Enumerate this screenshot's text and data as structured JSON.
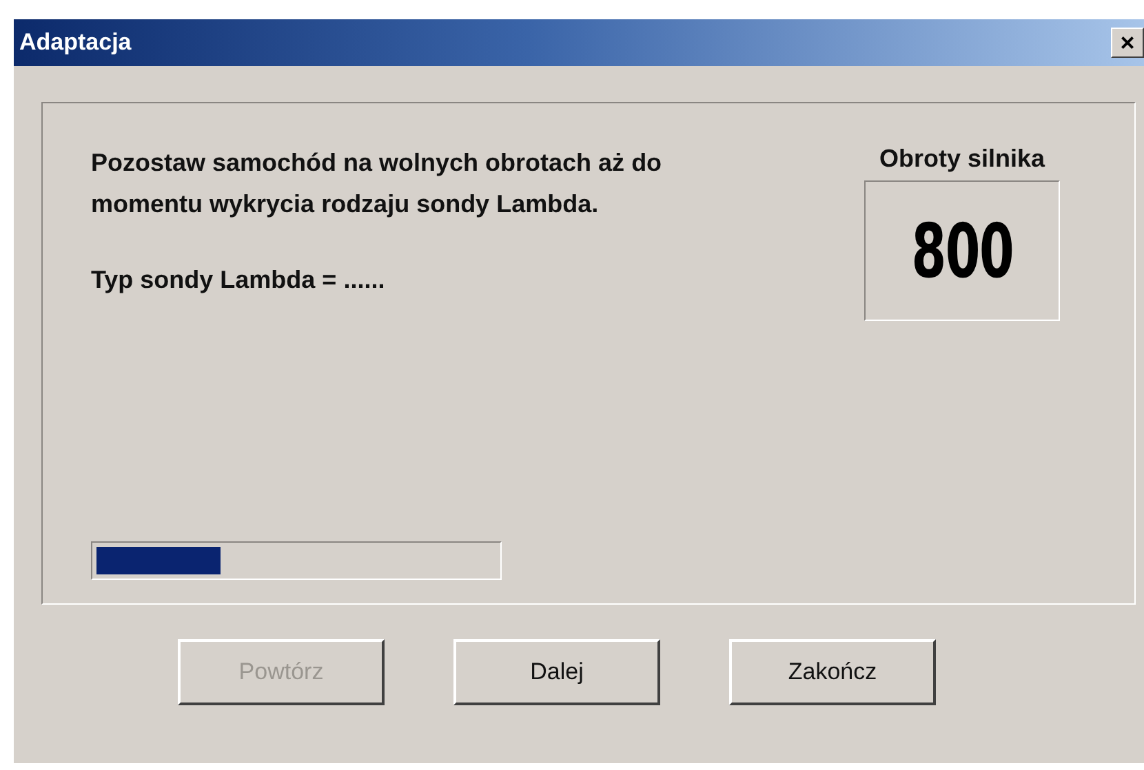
{
  "window": {
    "title": "Adaptacja",
    "close": "×"
  },
  "instruction": "Pozostaw samochód  na wolnych obrotach aż do momentu wykrycia rodzaju sondy Lambda.",
  "sensor_type": "Typ sondy Lambda = ......",
  "rpm": {
    "label": "Obroty silnika",
    "value": "800"
  },
  "progress": {
    "level": 0.31
  },
  "buttons": [
    {
      "label": "Powtórz",
      "disabled": true
    },
    {
      "label": "Dalej",
      "disabled": false
    },
    {
      "label": "Zakończ",
      "disabled": false
    }
  ]
}
